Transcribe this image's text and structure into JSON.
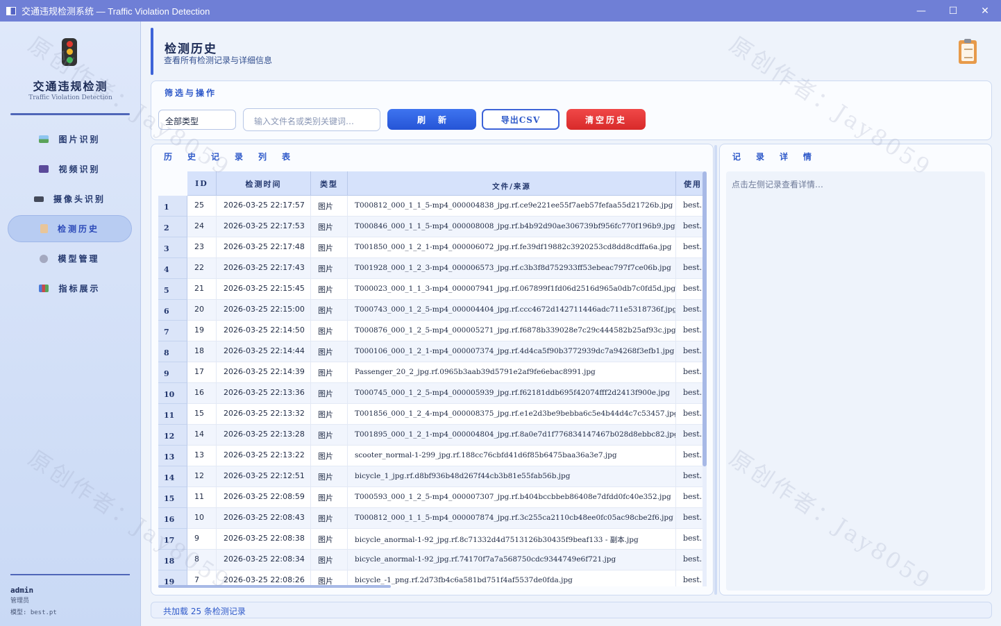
{
  "window": {
    "title": "交通违规检测系统 — Traffic Violation Detection",
    "controls": [
      "—",
      "☐",
      "✕"
    ]
  },
  "sidebar": {
    "brand_cn": "交通违规检测",
    "brand_en": "Traffic Violation Detection",
    "items": [
      {
        "label": "图片识别",
        "icon": "image-icon",
        "color": "#5aa35a"
      },
      {
        "label": "视频识别",
        "icon": "film-icon",
        "color": "#5b4a9a"
      },
      {
        "label": "摄像头识别",
        "icon": "camera-icon",
        "color": "#444a5a"
      },
      {
        "label": "检测历史",
        "icon": "clipboard-icon",
        "color": "#d9a066",
        "active": true
      },
      {
        "label": "模型管理",
        "icon": "gear-icon",
        "color": "#8a8fa8"
      },
      {
        "label": "指标展示",
        "icon": "bar-chart-icon",
        "color": "#c84a4a"
      }
    ],
    "user": {
      "name": "admin",
      "role": "管理员",
      "model": "模型: best.pt"
    }
  },
  "header": {
    "title": "检测历史",
    "subtitle": "查看所有检测记录与详细信息"
  },
  "filter": {
    "section_title": "筛选与操作",
    "type_select": "全部类型",
    "search_placeholder": "输入文件名或类别关键词…",
    "refresh_label": "刷新",
    "export_label": "导出CSV",
    "clear_label": "清空历史"
  },
  "history": {
    "section_title": "历史记录列表",
    "columns": [
      "ID",
      "检测时间",
      "类型",
      "文件/来源",
      "使用"
    ],
    "rows": [
      {
        "n": "1",
        "id": "25",
        "time": "2026-03-25 22:17:57",
        "type": "图片",
        "file": "T000812_000_1_1_5-mp4_000004838_jpg.rf.ce9e221ee55f7aeb57fefaa55d21726b.jpg",
        "model": "best."
      },
      {
        "n": "2",
        "id": "24",
        "time": "2026-03-25 22:17:53",
        "type": "图片",
        "file": "T000846_000_1_1_5-mp4_000008008_jpg.rf.b4b92d90ae306739bf956fc770f196b9.jpg",
        "model": "best."
      },
      {
        "n": "3",
        "id": "23",
        "time": "2026-03-25 22:17:48",
        "type": "图片",
        "file": "T001850_000_1_2_1-mp4_000006072_jpg.rf.fe39df19882c3920253cd8dd8cdffa6a.jpg",
        "model": "best."
      },
      {
        "n": "4",
        "id": "22",
        "time": "2026-03-25 22:17:43",
        "type": "图片",
        "file": "T001928_000_1_2_3-mp4_000006573_jpg.rf.c3b3f8d752933ff53ebeac797f7ce06b.jpg",
        "model": "best."
      },
      {
        "n": "5",
        "id": "21",
        "time": "2026-03-25 22:15:45",
        "type": "图片",
        "file": "T000023_000_1_1_3-mp4_000007941_jpg.rf.067899f1fd06d2516d965a0db7c0fd5d.jpg",
        "model": "best."
      },
      {
        "n": "6",
        "id": "20",
        "time": "2026-03-25 22:15:00",
        "type": "图片",
        "file": "T000743_000_1_2_5-mp4_000004404_jpg.rf.ccc4672d142711446adc711e5318736f.jpg",
        "model": "best."
      },
      {
        "n": "7",
        "id": "19",
        "time": "2026-03-25 22:14:50",
        "type": "图片",
        "file": "T000876_000_1_2_5-mp4_000005271_jpg.rf.f6878b339028e7c29c444582b25af93c.jpg",
        "model": "best."
      },
      {
        "n": "8",
        "id": "18",
        "time": "2026-03-25 22:14:44",
        "type": "图片",
        "file": "T000106_000_1_2_1-mp4_000007374_jpg.rf.4d4ca5f90b3772939dc7a94268f3efb1.jpg",
        "model": "best."
      },
      {
        "n": "9",
        "id": "17",
        "time": "2026-03-25 22:14:39",
        "type": "图片",
        "file": "Passenger_20_2_jpg.rf.0965b3aab39d5791e2af9fe6ebac8991.jpg",
        "model": "best."
      },
      {
        "n": "10",
        "id": "16",
        "time": "2026-03-25 22:13:36",
        "type": "图片",
        "file": "T000745_000_1_2_5-mp4_000005939_jpg.rf.f62181ddb695f42074fff2d2413f900e.jpg",
        "model": "best."
      },
      {
        "n": "11",
        "id": "15",
        "time": "2026-03-25 22:13:32",
        "type": "图片",
        "file": "T001856_000_1_2_4-mp4_000008375_jpg.rf.e1e2d3be9bebba6c5e4b44d4c7c53457.jpg",
        "model": "best."
      },
      {
        "n": "12",
        "id": "14",
        "time": "2026-03-25 22:13:28",
        "type": "图片",
        "file": "T001895_000_1_2_1-mp4_000004804_jpg.rf.8a0e7d1f776834147467b028d8ebbc82.jpg",
        "model": "best."
      },
      {
        "n": "13",
        "id": "13",
        "time": "2026-03-25 22:13:22",
        "type": "图片",
        "file": "scooter_normal-1-299_jpg.rf.188cc76cbfd41d6f85b6475baa36a3e7.jpg",
        "model": "best."
      },
      {
        "n": "14",
        "id": "12",
        "time": "2026-03-25 22:12:51",
        "type": "图片",
        "file": "bicycle_1_jpg.rf.d8bf936b48d267f44cb3b81e55fab56b.jpg",
        "model": "best."
      },
      {
        "n": "15",
        "id": "11",
        "time": "2026-03-25 22:08:59",
        "type": "图片",
        "file": "T000593_000_1_2_5-mp4_000007307_jpg.rf.b404bccbbeb86408e7dfdd0fc40e352.jpg",
        "model": "best."
      },
      {
        "n": "16",
        "id": "10",
        "time": "2026-03-25 22:08:43",
        "type": "图片",
        "file": "T000812_000_1_1_5-mp4_000007874_jpg.rf.3c255ca2110cb48ee0fc05ac98cbe2f6.jpg",
        "model": "best."
      },
      {
        "n": "17",
        "id": "9",
        "time": "2026-03-25 22:08:38",
        "type": "图片",
        "file": "bicycle_anormal-1-92_jpg.rf.8c71332d4d7513126b30435f9beaf133 - 副本.jpg",
        "model": "best."
      },
      {
        "n": "18",
        "id": "8",
        "time": "2026-03-25 22:08:34",
        "type": "图片",
        "file": "bicycle_anormal-1-92_jpg.rf.74170f7a7a568750cdc9344749e6f721.jpg",
        "model": "best."
      },
      {
        "n": "19",
        "id": "7",
        "time": "2026-03-25 22:08:26",
        "type": "图片",
        "file": "bicycle_-1_png.rf.2d73fb4c6a581bd751f4af5537de0fda.jpg",
        "model": "best."
      }
    ]
  },
  "detail": {
    "section_title": "记录详情",
    "placeholder": "点击左侧记录查看详情…"
  },
  "status": {
    "text": "共加载 25 条检测记录"
  },
  "watermark": "原创作者：Jay8059",
  "colors": {
    "accent": "#2e59c9",
    "titlebar": "#6f7fd6",
    "danger": "#e03a3a"
  }
}
